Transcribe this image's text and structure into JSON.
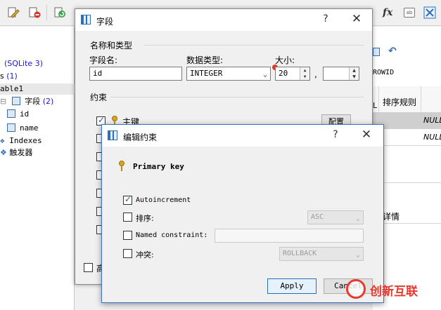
{
  "tree": {
    "db_label": "(SQLite 3)",
    "tables_label": "s",
    "tables_count": "(1)",
    "table_name": "able1",
    "fields_label": "字段",
    "fields_count": "(2)",
    "field_items": [
      "id",
      "name"
    ],
    "indexes_label": "Indexes",
    "triggers_label": "触发器"
  },
  "right_pane": {
    "rowid_label": "ROWID",
    "col_l": "L",
    "col_sort": "排序规则",
    "null_values": [
      "NULL",
      "NULL"
    ],
    "detail_label": "详情"
  },
  "field_dialog": {
    "title": "字段",
    "help": "?",
    "close": "✕",
    "group_name_type": "名称和类型",
    "label_name": "字段名:",
    "label_type": "数据类型:",
    "label_size": "大小:",
    "name_value": "id",
    "type_value": "INTEGER",
    "size_value": "20",
    "size_separator": ",",
    "group_constraints": "约束",
    "pk_label": "主键",
    "config_button": "配置",
    "advanced_label": "高"
  },
  "constraint_dialog": {
    "title": "编辑约束",
    "help": "?",
    "close": "✕",
    "constraint_name": "Primary key",
    "autoincrement_label": "Autoincrement",
    "sort_label": "排序:",
    "sort_value": "ASC",
    "named_constraint_label": "Named constraint:",
    "conflict_label": "冲突:",
    "conflict_value": "ROLLBACK",
    "apply_button": "Apply",
    "cancel_button": "Cancel",
    "autoincrement_checked": true,
    "sort_checked": false,
    "named_checked": false,
    "conflict_checked": false
  },
  "watermark": "创新互联",
  "toolbar_icons": [
    "edit-icon",
    "delete-icon",
    "refresh-icon",
    "function-icon",
    "format-icon",
    "grid-icon"
  ]
}
